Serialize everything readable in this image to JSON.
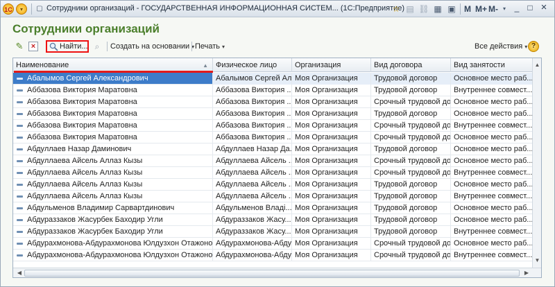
{
  "titlebar": {
    "title": "Сотрудники организаций - ГОСУДАРСТВЕННАЯ ИНФОРМАЦИОННАЯ СИСТЕМ... (1С:Предприятие)",
    "logo": "1С",
    "m_label": "M",
    "mplus_label": "M+",
    "mminus_label": "M-",
    "minimize": "_",
    "maximize": "□",
    "close": "×"
  },
  "form": {
    "title": "Сотрудники организаций"
  },
  "toolbar": {
    "find_label": "Найти...",
    "create_based_label": "Создать на основании",
    "print_label": "Печать",
    "all_actions_label": "Все действия",
    "help_label": "?"
  },
  "table": {
    "columns": [
      "Наименование",
      "Физическое лицо",
      "Организация",
      "Вид договора",
      "Вид занятости"
    ],
    "rows": [
      [
        "Абалымов Сергей Александрович",
        "Абалымов Сергей Ал...",
        "Моя Организация",
        "Трудовой договор",
        "Основное место раб..."
      ],
      [
        "Аббазова Виктория Маратовна",
        "Аббазова Виктория ...",
        "Моя Организация",
        "Трудовой договор",
        "Внутреннее совмест..."
      ],
      [
        "Аббазова Виктория Маратовна",
        "Аббазова Виктория ...",
        "Моя Организация",
        "Срочный трудовой до...",
        "Основное место раб..."
      ],
      [
        "Аббазова Виктория Маратовна",
        "Аббазова Виктория ...",
        "Моя Организация",
        "Трудовой договор",
        "Основное место раб..."
      ],
      [
        "Аббазова Виктория Маратовна",
        "Аббазова Виктория ...",
        "Моя Организация",
        "Срочный трудовой до...",
        "Внутреннее совмест..."
      ],
      [
        "Аббазова Виктория Маратовна",
        "Аббазова Виктория ...",
        "Моя Организация",
        "Срочный трудовой до...",
        "Основное место раб..."
      ],
      [
        "Абдуллаев Назар Даминович",
        "Абдуллаев Назар Да...",
        "Моя Организация",
        "Трудовой договор",
        "Основное место раб..."
      ],
      [
        "Абдуллаева Айсель Аллаз Кызы",
        "Абдуллаева Айсель ...",
        "Моя Организация",
        "Срочный трудовой до...",
        "Основное место раб..."
      ],
      [
        "Абдуллаева Айсель Аллаз Кызы",
        "Абдуллаева Айсель ...",
        "Моя Организация",
        "Срочный трудовой до...",
        "Внутреннее совмест..."
      ],
      [
        "Абдуллаева Айсель Аллаз Кызы",
        "Абдуллаева Айсель ...",
        "Моя Организация",
        "Трудовой договор",
        "Основное место раб..."
      ],
      [
        "Абдуллаева Айсель Аллаз Кызы",
        "Абдуллаева Айсель ...",
        "Моя Организация",
        "Трудовой договор",
        "Внутреннее совмест..."
      ],
      [
        "Абдульменов Владимир Сарвартдинович",
        "Абдульменов Владі...",
        "Моя Организация",
        "Трудовой договор",
        "Основное место раб..."
      ],
      [
        "Абдураззаков Жасурбек Баходир Угли",
        "Абдураззаков Жасу...",
        "Моя Организация",
        "Трудовой договор",
        "Основное место раб..."
      ],
      [
        "Абдураззаков Жасурбек Баходир Угли",
        "Абдураззаков Жасу...",
        "Моя Организация",
        "Трудовой договор",
        "Внутреннее совмест..."
      ],
      [
        "Абдурахмонова-Абдурахмонова Юлдузхон Отажоновна",
        "Абдурахмонова-Абду...",
        "Моя Организация",
        "Срочный трудовой до...",
        "Основное место раб..."
      ],
      [
        "Абдурахмонова-Абдурахмонова Юлдузхон Отажоновна",
        "Абдурахмонова-Абду...",
        "Моя Организация",
        "Срочный трудовой до...",
        "Внутреннее совмест..."
      ]
    ],
    "selected_row": 0
  },
  "colors": {
    "title_green": "#4b7f2c",
    "selection_blue": "#3d7cc9",
    "highlight_red": "#e31a1a"
  }
}
